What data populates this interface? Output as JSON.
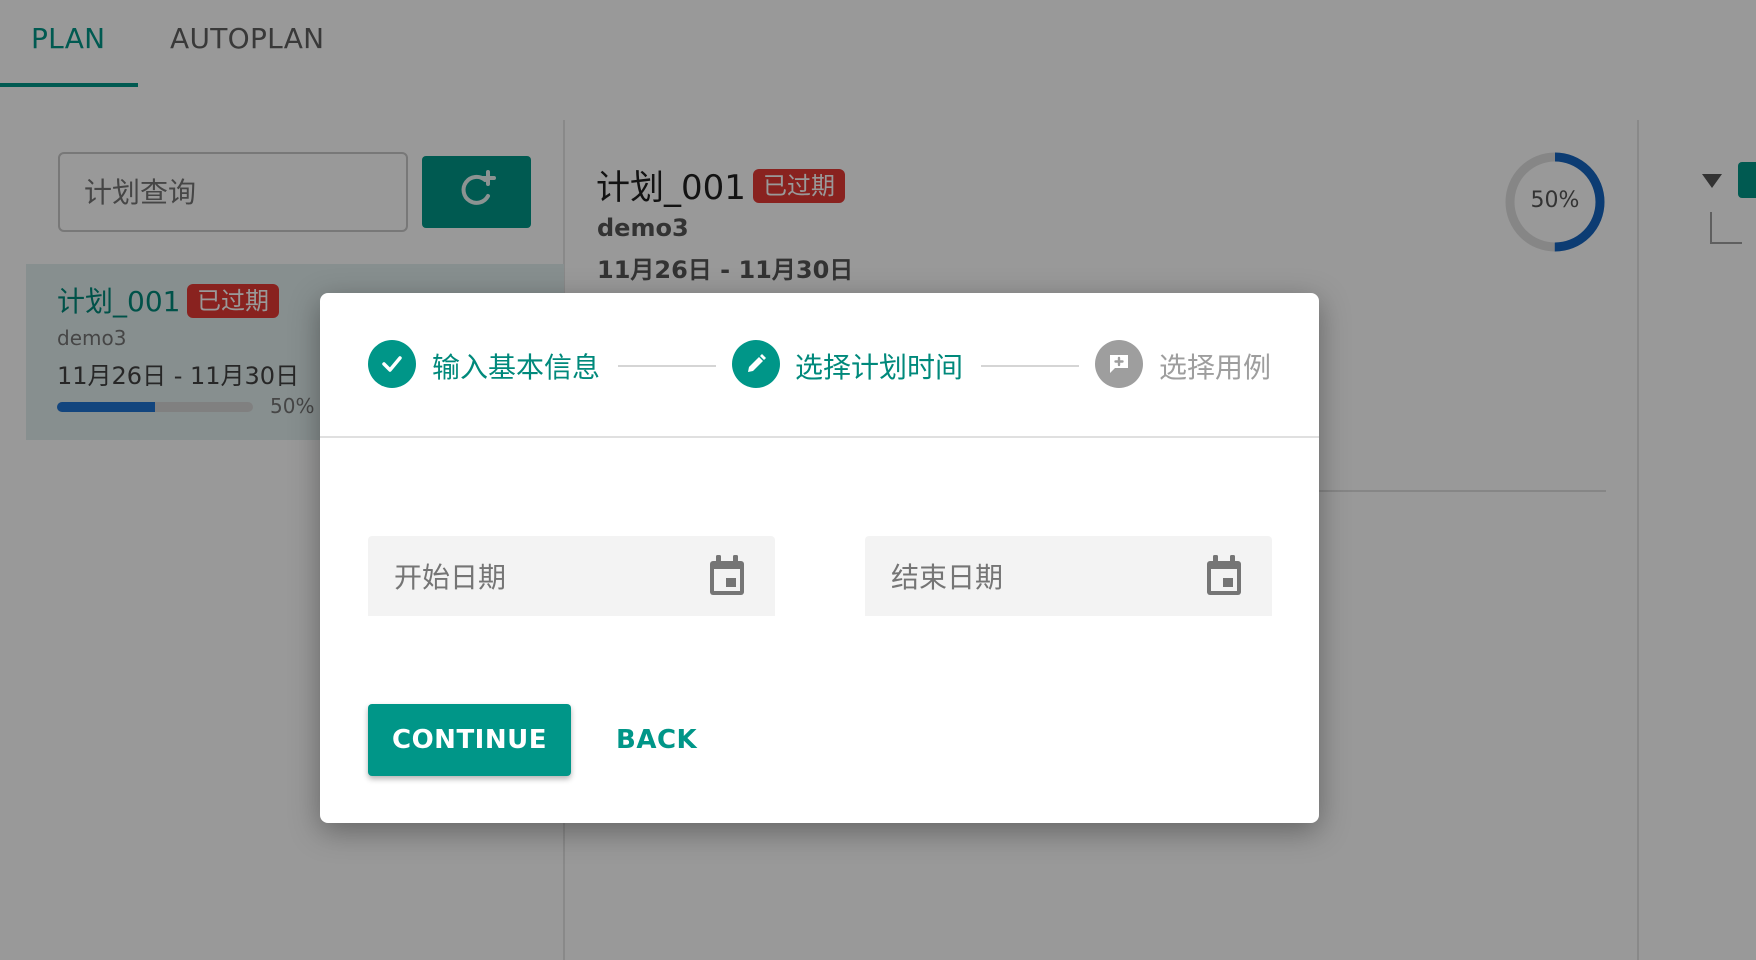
{
  "tabs": [
    {
      "label": "PLAN",
      "active": true
    },
    {
      "label": "AUTOPLAN",
      "active": false
    }
  ],
  "search": {
    "placeholder": "计划查询"
  },
  "plan_list": [
    {
      "title": "计划_001",
      "status": "已过期",
      "subtitle": "demo3",
      "date_range": "11月26日 - 11月30日",
      "progress_percent": 50,
      "progress_label": "50%"
    }
  ],
  "detail": {
    "title": "计划_001",
    "status": "已过期",
    "subtitle": "demo3",
    "date_range": "11月26日 - 11月30日",
    "progress_percent": 50,
    "progress_label": "50%"
  },
  "dialog": {
    "steps": [
      {
        "label": "输入基本信息",
        "state": "completed",
        "icon": "check-icon"
      },
      {
        "label": "选择计划时间",
        "state": "active",
        "icon": "pencil-icon"
      },
      {
        "label": "选择用例",
        "state": "pending",
        "icon": "add-comment-icon"
      }
    ],
    "start_date": {
      "placeholder": "开始日期",
      "value": ""
    },
    "end_date": {
      "placeholder": "结束日期",
      "value": ""
    },
    "continue_label": "CONTINUE",
    "back_label": "BACK"
  },
  "colors": {
    "accent": "#009688",
    "badge": "#e53935",
    "progress": "#1e74d2",
    "overlay": "rgba(0,0,0,0.4)"
  }
}
